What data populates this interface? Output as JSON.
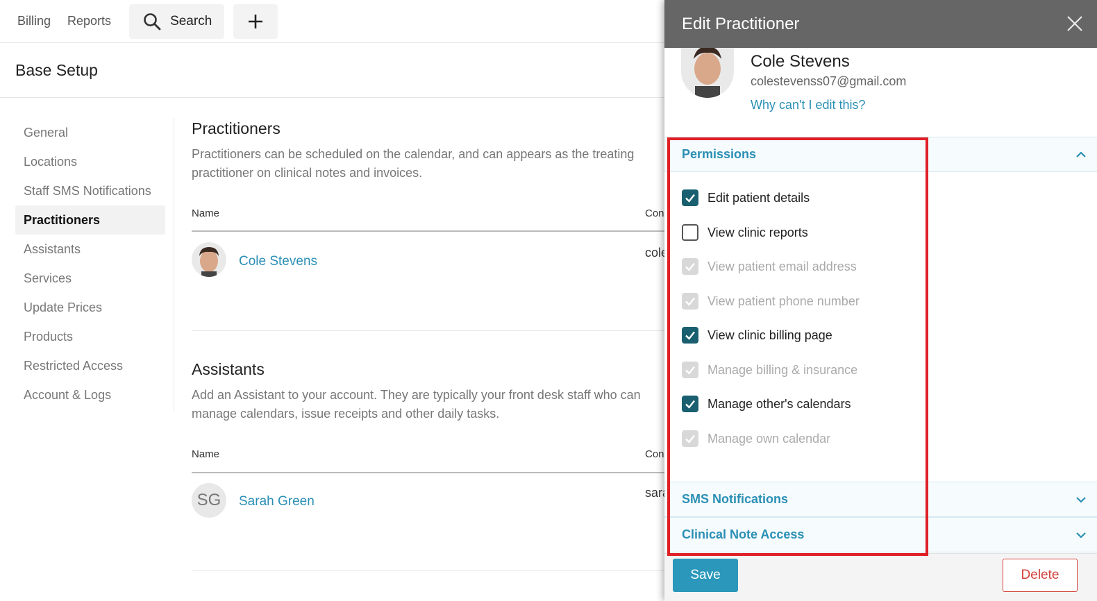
{
  "nav": {
    "billing": "Billing",
    "reports": "Reports",
    "search": "Search",
    "search_icon": "search-icon",
    "plus_icon": "plus-icon"
  },
  "page_title": "Base Setup",
  "sidebar": {
    "items": [
      {
        "label": "General"
      },
      {
        "label": "Locations"
      },
      {
        "label": "Staff SMS Notifications"
      },
      {
        "label": "Practitioners",
        "active": true
      },
      {
        "label": "Assistants"
      },
      {
        "label": "Services"
      },
      {
        "label": "Update Prices"
      },
      {
        "label": "Products"
      },
      {
        "label": "Restricted Access"
      },
      {
        "label": "Account & Logs"
      }
    ]
  },
  "practitioners": {
    "title": "Practitioners",
    "description": "Practitioners can be scheduled on the calendar, and can appears as the treating practitioner on clinical notes and invoices.",
    "col_name": "Name",
    "col_contact": "Con",
    "rows": [
      {
        "name": "Cole Stevens",
        "contact": "cole"
      }
    ]
  },
  "assistants": {
    "title": "Assistants",
    "description": "Add an Assistant to your account. They are typically your front desk staff who can manage calendars, issue receipts and other daily tasks.",
    "col_name": "Name",
    "col_contact": "Con",
    "rows": [
      {
        "initials": "SG",
        "name": "Sarah Green",
        "contact": "sara"
      }
    ]
  },
  "panel": {
    "title": "Edit Practitioner",
    "close_icon": "close-icon",
    "name": "Cole Stevens",
    "email": "colestevenss07@gmail.com",
    "why_link": "Why can't I edit this?",
    "sections": {
      "permissions": "Permissions",
      "sms": "SMS Notifications",
      "clinical": "Clinical Note Access"
    },
    "permissions": [
      {
        "label": "Edit patient details",
        "state": "checked"
      },
      {
        "label": "View clinic reports",
        "state": "unchecked"
      },
      {
        "label": "View patient email address",
        "state": "disabled"
      },
      {
        "label": "View patient phone number",
        "state": "disabled"
      },
      {
        "label": "View clinic billing page",
        "state": "checked"
      },
      {
        "label": "Manage billing & insurance",
        "state": "disabled"
      },
      {
        "label": "Manage other's calendars",
        "state": "checked"
      },
      {
        "label": "Manage own calendar",
        "state": "disabled"
      }
    ],
    "save": "Save",
    "delete": "Delete"
  },
  "colors": {
    "accent": "#2a8fb5",
    "checkbox": "#1a5f6f",
    "highlight": "#e02027",
    "delete": "#d2413a",
    "header": "#666666"
  }
}
